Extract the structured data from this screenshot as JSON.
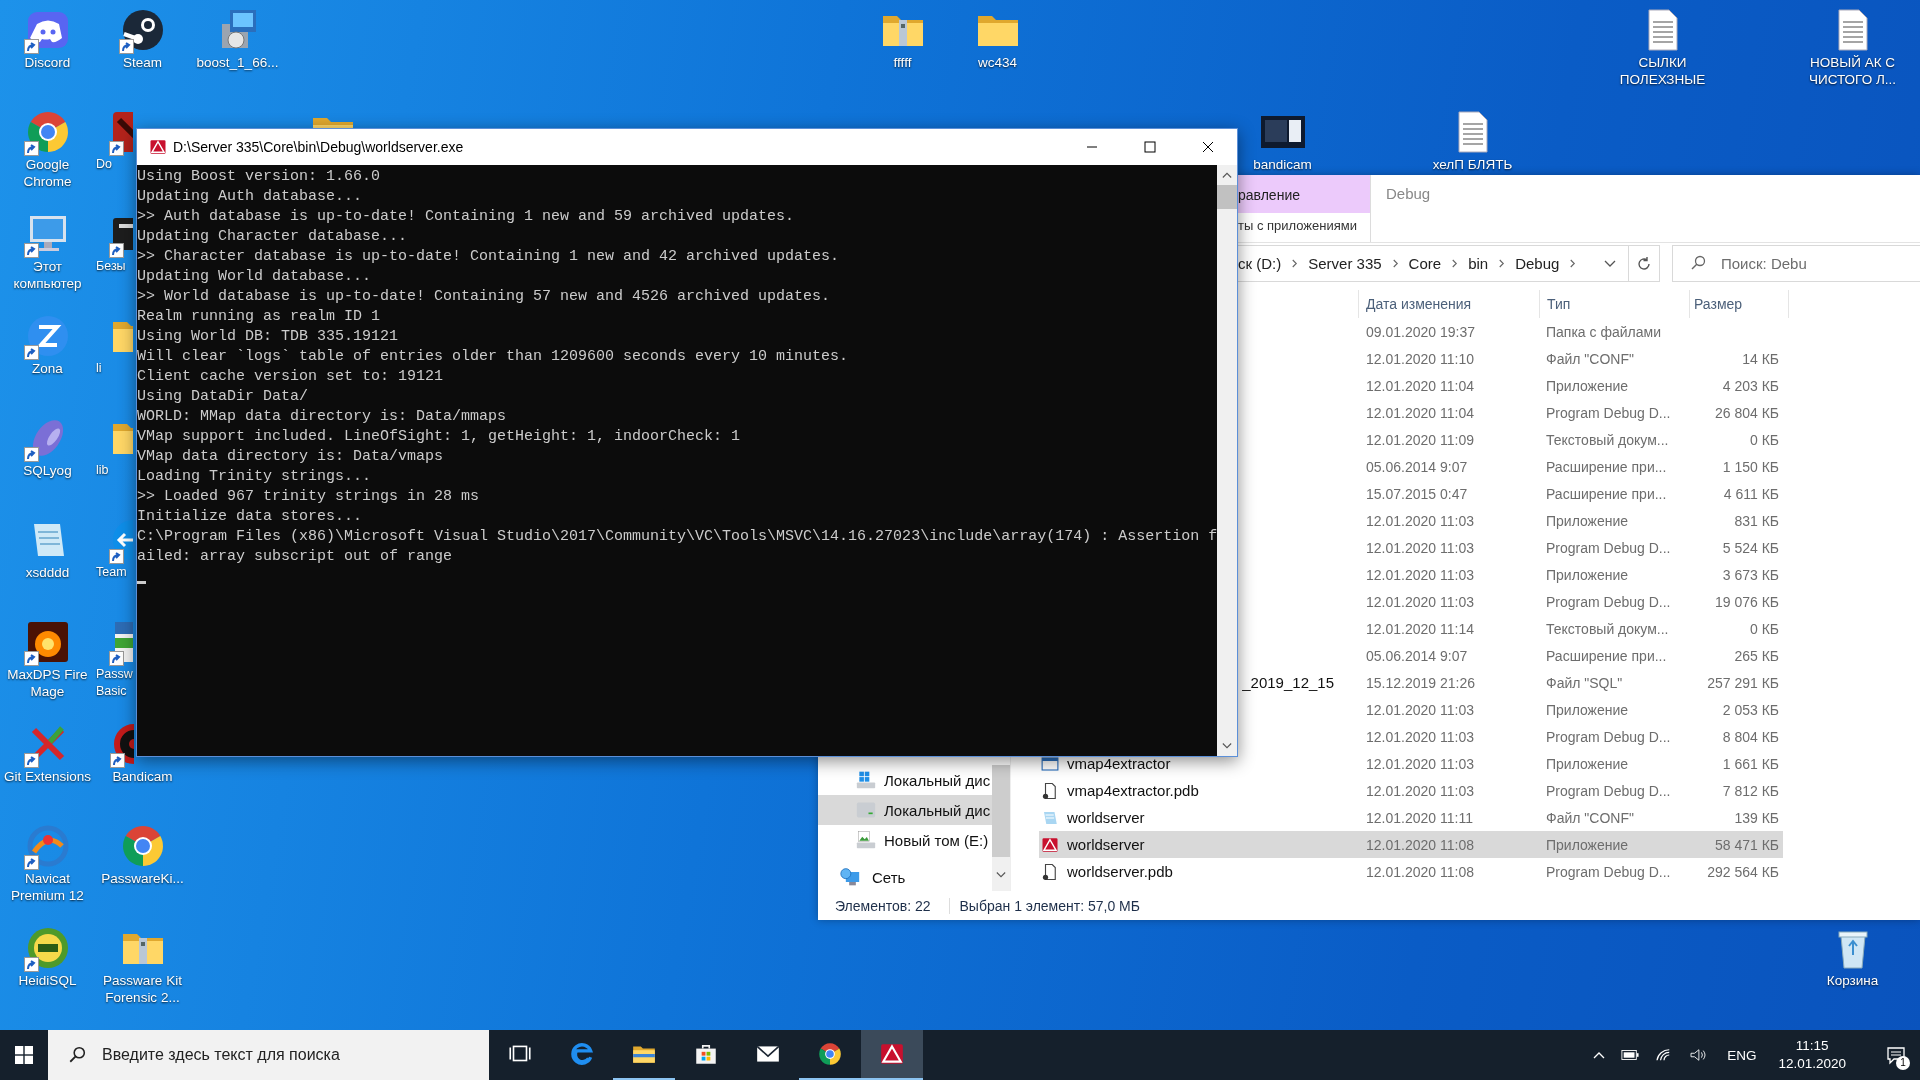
{
  "desktop_icons": [
    {
      "label": "Discord",
      "kind": "discord",
      "shortcut": true
    },
    {
      "label": "Steam",
      "kind": "steam",
      "shortcut": true
    },
    {
      "label": "boost_1_66...",
      "kind": "installer",
      "shortcut": false
    },
    {
      "label": "Google Chrome",
      "kind": "chrome",
      "shortcut": true
    },
    {
      "label": "Do",
      "kind": "red-app",
      "shortcut": true
    },
    {
      "kind": "folder"
    },
    {
      "label": "Этот компьютер",
      "kind": "computer",
      "shortcut": true
    },
    {
      "label": "Безы",
      "kind": "dark-app",
      "shortcut": true
    },
    {
      "label": "Zona",
      "kind": "zona",
      "shortcut": true
    },
    {
      "label": "li",
      "kind": "folder",
      "shortcut": false
    },
    {
      "label": "SQLyog",
      "kind": "sqlyog",
      "shortcut": true
    },
    {
      "label": "lib",
      "kind": "folder",
      "shortcut": false
    },
    {
      "label": "xsdddd",
      "kind": "notepad",
      "shortcut": false
    },
    {
      "label": "Team",
      "kind": "teamviewer",
      "shortcut": true
    },
    {
      "label": "MaxDPS Fire Mage",
      "kind": "game",
      "shortcut": true
    },
    {
      "label": "Passw Basic",
      "kind": "passw",
      "shortcut": true
    },
    {
      "label": "Git Extensions",
      "kind": "git",
      "shortcut": true
    },
    {
      "label": "Bandicam",
      "kind": "bandicam",
      "shortcut": true
    },
    {
      "label": "Navicat Premium 12",
      "kind": "navicat",
      "shortcut": true
    },
    {
      "label": "PasswareKi...",
      "kind": "chrome",
      "shortcut": false
    },
    {
      "label": "HeidiSQL",
      "kind": "heidisql",
      "shortcut": true
    },
    {
      "label": "Passware Kit Forensic 2...",
      "kind": "zip-folder",
      "shortcut": false
    },
    {
      "label": "fffff",
      "kind": "zip-folder",
      "shortcut": false
    },
    {
      "label": "wc434",
      "kind": "folder",
      "shortcut": false
    },
    {
      "label": "bandicam",
      "kind": "screen",
      "shortcut": false
    },
    {
      "label": "хелП БЛЯТЬ",
      "kind": "text-file",
      "shortcut": false
    },
    {
      "label": "СЫЛКИ ПОЛЕХЗНЫЕ",
      "kind": "text-file",
      "shortcut": false
    },
    {
      "label": "НОВЫЙ АК С ЧИСТОГО Л...",
      "kind": "text-file",
      "shortcut": false
    },
    {
      "label": "Корзина",
      "kind": "recycle-bin",
      "shortcut": false
    }
  ],
  "explorer": {
    "context_tab": "равление",
    "context_group": "ты с приложениями",
    "title": "Debug",
    "breadcrumb": [
      "ск (D:)",
      "Server 335",
      "Core",
      "bin",
      "Debug"
    ],
    "search": {
      "placeholder": "Поиск: Debu"
    },
    "columns": [
      "Дата изменения",
      "Тип",
      "Размер"
    ],
    "nav": [
      {
        "label": "Локальный дис",
        "kind": "windows-drive",
        "selected": false
      },
      {
        "label": "Локальный дис",
        "kind": "drive",
        "selected": true
      },
      {
        "label": "Новый том (E:)",
        "kind": "picture-drive",
        "selected": false
      },
      {
        "label": "Сеть",
        "kind": "network",
        "selected": false
      }
    ],
    "rows": [
      {
        "date": "09.01.2020 19:37",
        "type": "Папка с файлами",
        "selected": false
      },
      {
        "date": "12.01.2020 11:10",
        "type": "Файл \"CONF\"",
        "size": "14 КБ",
        "selected": false
      },
      {
        "date": "12.01.2020 11:04",
        "type": "Приложение",
        "size": "4 203 КБ",
        "selected": false
      },
      {
        "date": "12.01.2020 11:04",
        "type": "Program Debug D...",
        "size": "26 804 КБ",
        "selected": false
      },
      {
        "date": "12.01.2020 11:09",
        "type": "Текстовый докум...",
        "size": "0 КБ",
        "selected": false
      },
      {
        "date": "05.06.2014 9:07",
        "type": "Расширение при...",
        "size": "1 150 КБ",
        "selected": false
      },
      {
        "date": "15.07.2015 0:47",
        "type": "Расширение при...",
        "size": "4 611 КБ",
        "selected": false
      },
      {
        "date": "12.01.2020 11:03",
        "type": "Приложение",
        "size": "831 КБ",
        "selected": false
      },
      {
        "date": "12.01.2020 11:03",
        "type": "Program Debug D...",
        "size": "5 524 КБ",
        "selected": false
      },
      {
        "date": "12.01.2020 11:03",
        "type": "Приложение",
        "size": "3 673 КБ",
        "selected": false
      },
      {
        "date": "12.01.2020 11:03",
        "type": "Program Debug D...",
        "size": "19 076 КБ",
        "selected": false
      },
      {
        "date": "12.01.2020 11:14",
        "type": "Текстовый докум...",
        "size": "0 КБ",
        "selected": false
      },
      {
        "date": "05.06.2014 9:07",
        "type": "Расширение при...",
        "size": "265 КБ",
        "selected": false
      },
      {
        "name": "_2019_12_15",
        "date": "15.12.2019 21:26",
        "type": "Файл \"SQL\"",
        "size": "257 291 КБ",
        "selected": false
      },
      {
        "date": "12.01.2020 11:03",
        "type": "Приложение",
        "size": "2 053 КБ",
        "selected": false
      },
      {
        "date": "12.01.2020 11:03",
        "type": "Program Debug D...",
        "size": "8 804 КБ",
        "selected": false
      },
      {
        "name": "vmap4extractor",
        "kind": "app",
        "date": "12.01.2020 11:03",
        "type": "Приложение",
        "size": "1 661 КБ",
        "selected": false
      },
      {
        "name": "vmap4extractor.pdb",
        "kind": "pdb",
        "date": "12.01.2020 11:03",
        "type": "Program Debug D...",
        "size": "7 812 КБ",
        "selected": false
      },
      {
        "name": "worldserver",
        "kind": "conf",
        "date": "12.01.2020 11:11",
        "type": "Файл \"CONF\"",
        "size": "139 КБ",
        "selected": false
      },
      {
        "name": "worldserver",
        "kind": "server",
        "date": "12.01.2020 11:08",
        "type": "Приложение",
        "size": "58 471 КБ",
        "selected": true
      },
      {
        "name": "worldserver.pdb",
        "kind": "pdb",
        "date": "12.01.2020 11:08",
        "type": "Program Debug D...",
        "size": "292 564 КБ",
        "selected": false
      }
    ],
    "status": {
      "count": "Элементов: 22",
      "selection": "Выбран 1 элемент: 57,0 МБ"
    }
  },
  "console": {
    "title": "D:\\Server 335\\Core\\bin\\Debug\\worldserver.exe",
    "lines": [
      "Using Boost version: 1.66.0",
      "Updating Auth database...",
      ">> Auth database is up-to-date! Containing 1 new and 59 archived updates.",
      "Updating Character database...",
      ">> Character database is up-to-date! Containing 1 new and 42 archived updates.",
      "Updating World database...",
      ">> World database is up-to-date! Containing 57 new and 4526 archived updates.",
      "Realm running as realm ID 1",
      "Using World DB: TDB 335.19121",
      "Will clear `logs` table of entries older than 1209600 seconds every 10 minutes.",
      "Client cache version set to: 19121",
      "Using DataDir Data/",
      "WORLD: MMap data directory is: Data/mmaps",
      "VMap support included. LineOfSight: 1, getHeight: 1, indoorCheck: 1",
      "VMap data directory is: Data/vmaps",
      "Loading Trinity strings...",
      ">> Loaded 967 trinity strings in 28 ms",
      "Initialize data stores...",
      "C:\\Program Files (x86)\\Microsoft Visual Studio\\2017\\Community\\VC\\Tools\\MSVC\\14.16.27023\\include\\array(174) : Assertion f",
      "ailed: array subscript out of range"
    ]
  },
  "taskbar": {
    "search": {
      "placeholder": "Введите здесь текст для поиска"
    },
    "apps": [
      {
        "kind": "task-view",
        "running": false,
        "selected": false
      },
      {
        "kind": "edge",
        "running": false,
        "selected": false
      },
      {
        "kind": "explorer",
        "running": true,
        "selected": false
      },
      {
        "kind": "store",
        "running": false,
        "selected": false
      },
      {
        "kind": "mail",
        "running": false,
        "selected": false
      },
      {
        "kind": "chrome",
        "running": true,
        "selected": false
      },
      {
        "kind": "server",
        "running": true,
        "selected": true
      }
    ],
    "language": "ENG",
    "time": "11:15",
    "date": "12.01.2020",
    "notifications": "1"
  }
}
